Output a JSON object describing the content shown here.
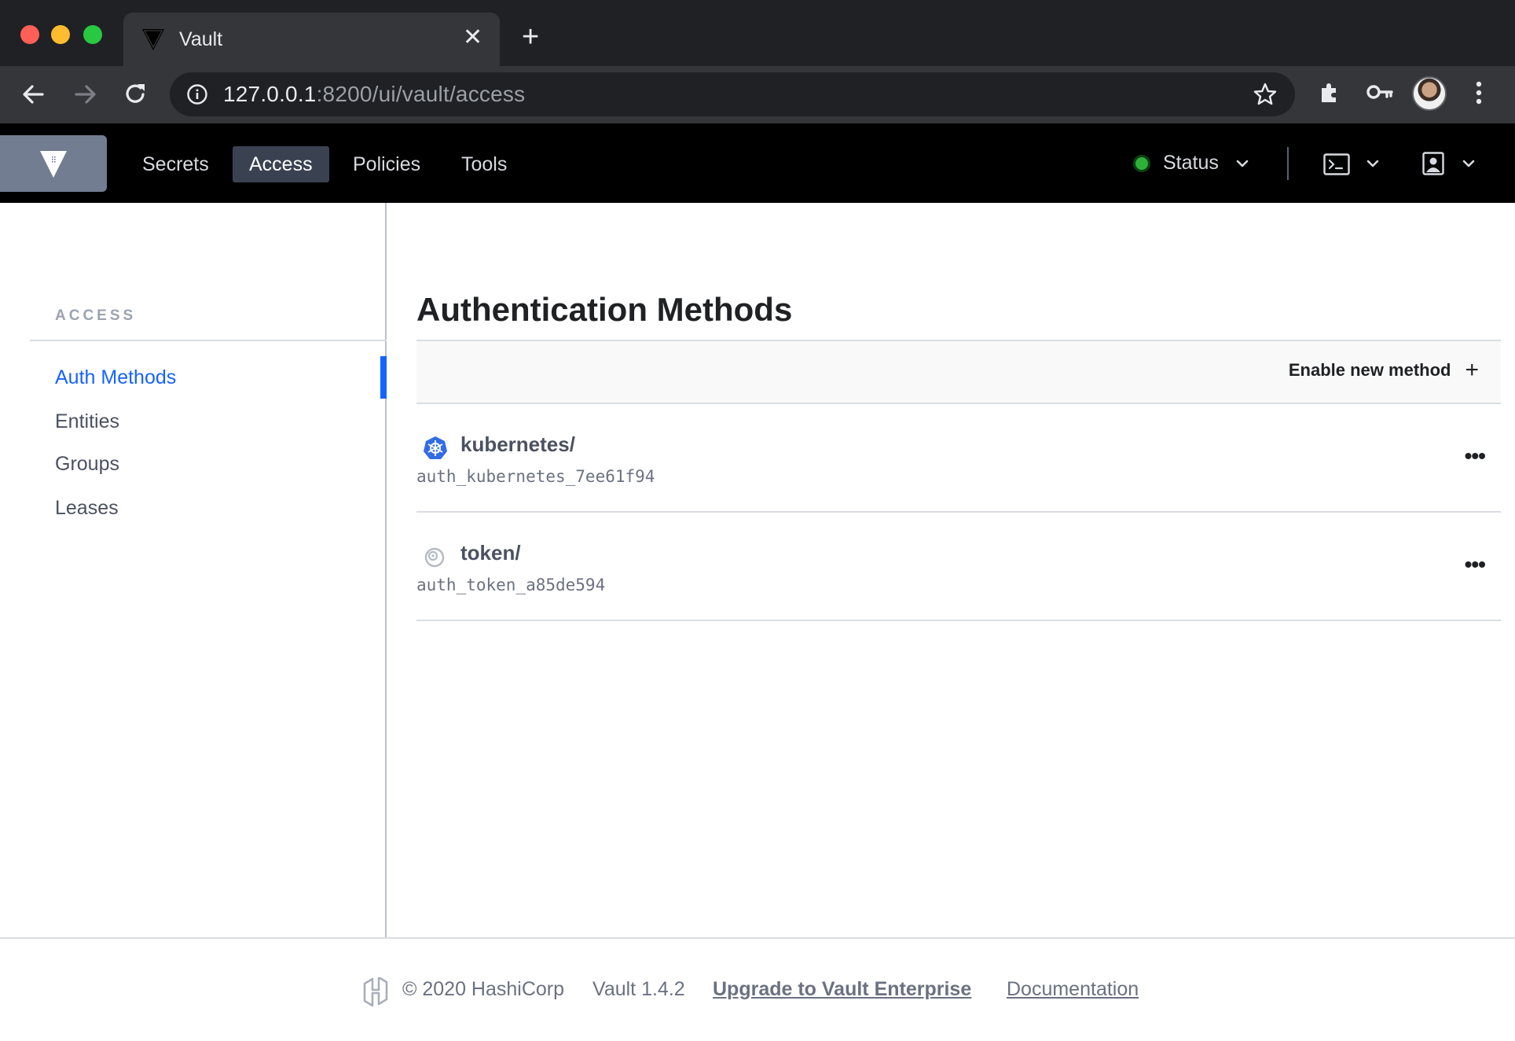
{
  "browser": {
    "tab_title": "Vault",
    "url_host": "127.0.0.1",
    "url_rest": ":8200/ui/vault/access"
  },
  "vault_nav": {
    "links": [
      {
        "label": "Secrets"
      },
      {
        "label": "Access"
      },
      {
        "label": "Policies"
      },
      {
        "label": "Tools"
      }
    ],
    "active": "Access",
    "status_label": "Status",
    "status_color": "#2eb039"
  },
  "sidebar": {
    "heading": "ACCESS",
    "items": [
      {
        "label": "Auth Methods"
      },
      {
        "label": "Entities"
      },
      {
        "label": "Groups"
      },
      {
        "label": "Leases"
      }
    ],
    "active": "Auth Methods"
  },
  "main": {
    "title": "Authentication Methods",
    "enable_label": "Enable new method",
    "methods": [
      {
        "path": "kubernetes/",
        "accessor": "auth_kubernetes_7ee61f94",
        "icon": "kubernetes-icon",
        "menu": "•••"
      },
      {
        "path": "token/",
        "accessor": "auth_token_a85de594",
        "icon": "token-icon",
        "menu": "•••"
      }
    ]
  },
  "footer": {
    "copyright": "© 2020 HashiCorp",
    "version": "Vault 1.4.2",
    "upgrade_link": "Upgrade to Vault Enterprise",
    "docs_link": "Documentation"
  },
  "colors": {
    "accent": "#1563ff",
    "nav_bg": "#000000",
    "active_nav": "#3a4252"
  }
}
